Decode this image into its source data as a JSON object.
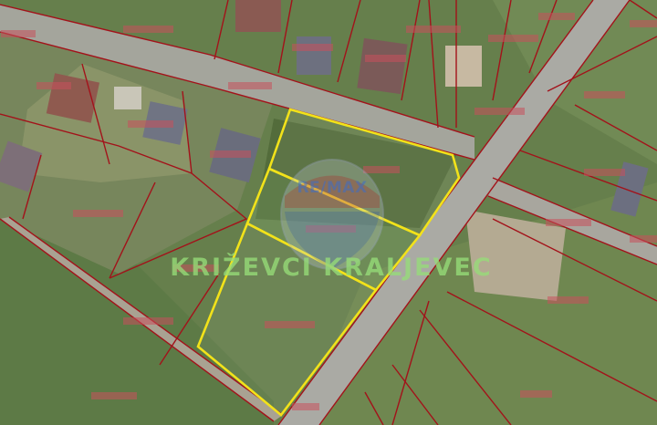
{
  "map": {
    "watermark_text": "KRIŽEVCI KRALJEVEC",
    "logo_text": "RE/MAX",
    "colors": {
      "parcel_lines": "#a3121a",
      "highlight": "#f2e21a",
      "road": "#a9a9a4",
      "field": "#6f8a4f",
      "field_light": "#86a066",
      "field_dark": "#4f6a3c",
      "roof_red": "#8a4a45",
      "roof_grey": "#6b6f7c"
    },
    "highlighted_parcels": 3
  }
}
